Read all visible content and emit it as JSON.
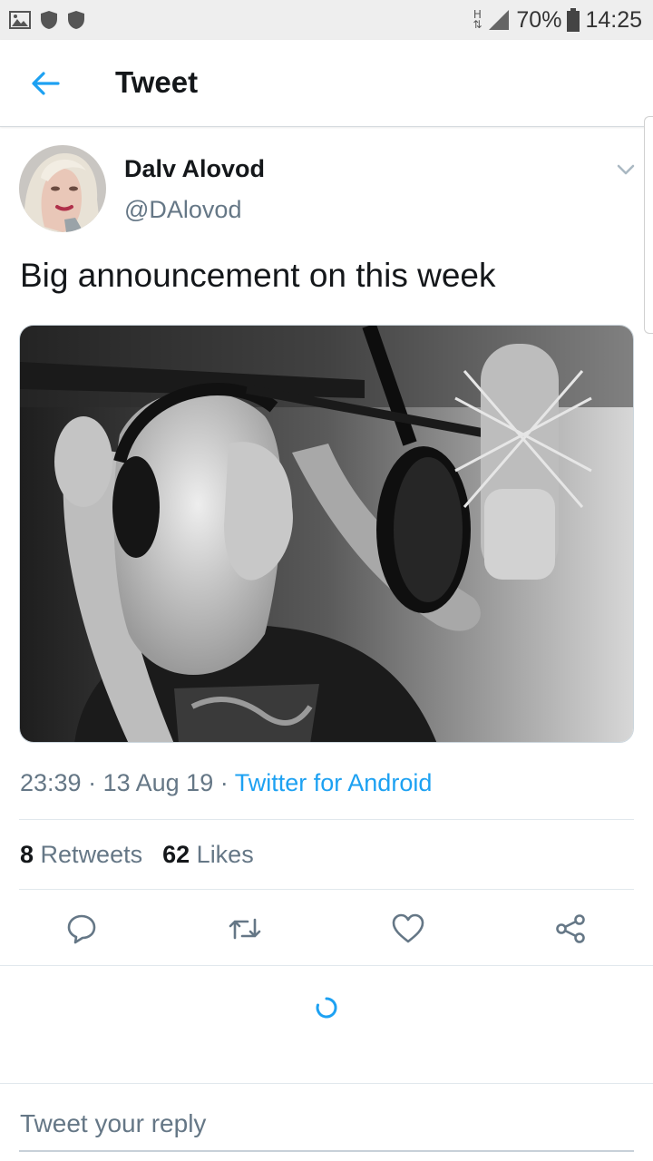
{
  "status_bar": {
    "network": "H",
    "battery": "70%",
    "time": "14:25"
  },
  "header": {
    "title": "Tweet"
  },
  "tweet": {
    "author_name": "Dalv Alovod",
    "author_handle": "@DAlovod",
    "text": "Big announcement on this week",
    "time": "23:39",
    "date": "13 Aug 19",
    "source": "Twitter for Android",
    "retweets_count": "8",
    "retweets_label": "Retweets",
    "likes_count": "62",
    "likes_label": "Likes"
  },
  "reply": {
    "placeholder": "Tweet your reply"
  },
  "colors": {
    "accent": "#1da1f2",
    "secondary_text": "#657786",
    "primary_text": "#14171a"
  },
  "icons": {
    "back": "arrow-left-icon",
    "caret": "chevron-down-icon",
    "reply": "comment-icon",
    "retweet": "retweet-icon",
    "like": "heart-icon",
    "share": "share-icon",
    "loading": "spinner-icon"
  }
}
